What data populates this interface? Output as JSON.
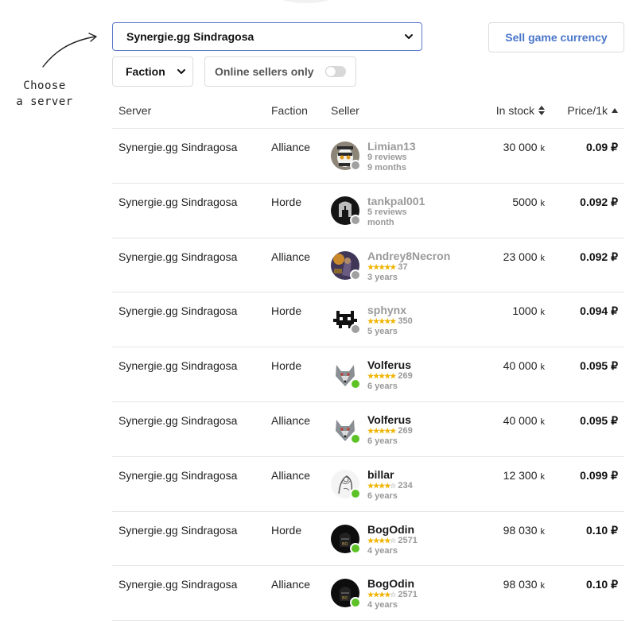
{
  "hint": {
    "line1": "Choose",
    "line2": "a server"
  },
  "filters": {
    "server_value": "Synergie.gg Sindragosa",
    "faction_value": "Faction",
    "online_label": "Online sellers only",
    "online_enabled": false,
    "sell_label": "Sell game currency"
  },
  "colors": {
    "accent": "#4a76c9",
    "online": "#5cc226",
    "offline": "#a0a0a0",
    "star": "#f0b400"
  },
  "table": {
    "headers": {
      "server": "Server",
      "faction": "Faction",
      "seller": "Seller",
      "stock": "In stock",
      "price": "Price/1k"
    },
    "rows": [
      {
        "server": "Synergie.gg Sindragosa",
        "faction": "Alliance",
        "seller": "Limian13",
        "online": false,
        "avatar_icon": "lemur-avatar-icon",
        "reviews": "9 reviews",
        "stars": 0,
        "rating_count": "",
        "age": "9 months",
        "stock": "30 000",
        "unit": "k",
        "price": "0.09 ₽"
      },
      {
        "server": "Synergie.gg Sindragosa",
        "faction": "Horde",
        "seller": "tankpal001",
        "online": false,
        "avatar_icon": "helmet-avatar-icon",
        "reviews": "5 reviews",
        "stars": 0,
        "rating_count": "",
        "age": "month",
        "stock": "5000",
        "unit": "k",
        "price": "0.092 ₽"
      },
      {
        "server": "Synergie.gg Sindragosa",
        "faction": "Alliance",
        "seller": "Andrey8Necron",
        "online": false,
        "avatar_icon": "warrior-avatar-icon",
        "reviews": "",
        "stars": 5,
        "rating_count": "37",
        "age": "3 years",
        "stock": "23 000",
        "unit": "k",
        "price": "0.092 ₽"
      },
      {
        "server": "Synergie.gg Sindragosa",
        "faction": "Horde",
        "seller": "sphynx",
        "online": false,
        "avatar_icon": "pixel-cat-avatar-icon",
        "reviews": "",
        "stars": 5,
        "rating_count": "350",
        "age": "5 years",
        "stock": "1000",
        "unit": "k",
        "price": "0.094 ₽"
      },
      {
        "server": "Synergie.gg Sindragosa",
        "faction": "Horde",
        "seller": "Volferus",
        "online": true,
        "avatar_icon": "wolf-avatar-icon",
        "reviews": "",
        "stars": 5,
        "rating_count": "269",
        "age": "6 years",
        "stock": "40 000",
        "unit": "k",
        "price": "0.095 ₽"
      },
      {
        "server": "Synergie.gg Sindragosa",
        "faction": "Alliance",
        "seller": "Volferus",
        "online": true,
        "avatar_icon": "wolf-avatar-icon",
        "reviews": "",
        "stars": 5,
        "rating_count": "269",
        "age": "6 years",
        "stock": "40 000",
        "unit": "k",
        "price": "0.095 ₽"
      },
      {
        "server": "Synergie.gg Sindragosa",
        "faction": "Alliance",
        "seller": "billar",
        "online": true,
        "avatar_icon": "sketch-avatar-icon",
        "reviews": "",
        "stars": 4,
        "rating_count": "234",
        "age": "6 years",
        "stock": "12 300",
        "unit": "k",
        "price": "0.099 ₽"
      },
      {
        "server": "Synergie.gg Sindragosa",
        "faction": "Horde",
        "seller": "BogOdin",
        "online": true,
        "avatar_icon": "dark-helmet-avatar-icon",
        "reviews": "",
        "stars": 4,
        "rating_count": "2571",
        "age": "4 years",
        "stock": "98 030",
        "unit": "k",
        "price": "0.10 ₽"
      },
      {
        "server": "Synergie.gg Sindragosa",
        "faction": "Alliance",
        "seller": "BogOdin",
        "online": true,
        "avatar_icon": "dark-helmet-avatar-icon",
        "reviews": "",
        "stars": 4,
        "rating_count": "2571",
        "age": "4 years",
        "stock": "98 030",
        "unit": "k",
        "price": "0.10 ₽"
      }
    ]
  }
}
